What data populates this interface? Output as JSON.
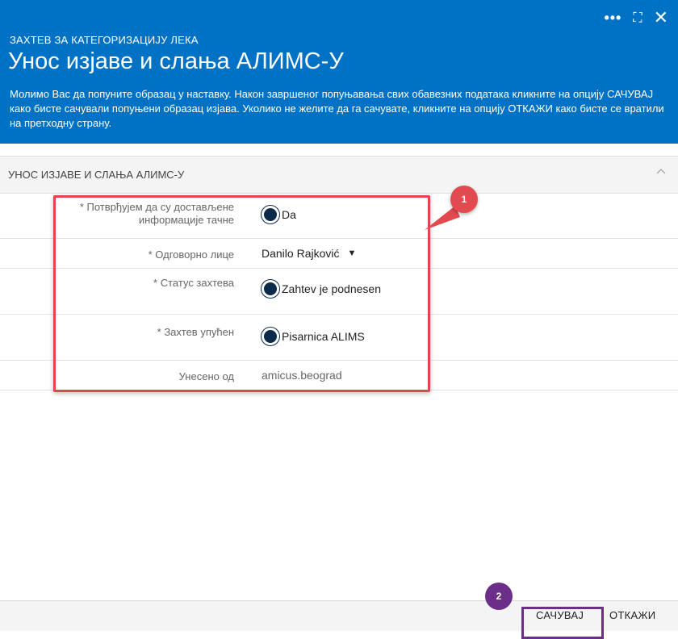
{
  "header": {
    "supertitle": "ЗАХТЕВ ЗА КАТЕГОРИЗАЦИЈУ ЛЕКА",
    "title": "Унос изјаве и слања АЛИМС-У",
    "description": "Молимо Вас да попуните образац у наставку. Након завршеног попуњавања свих обавезних података кликните на опцију САЧУВАЈ како бисте сачували попуњени образац изјава. Уколико не желите да га сачувате, кликните на опцију ОТКАЖИ како бисте се вратили на претходну страну.",
    "controls": {
      "more": "•••",
      "expand": "⛶",
      "close": "✕"
    }
  },
  "section": {
    "title": "УНОС ИЗЈАВЕ И СЛАЊА АЛИМС-У",
    "collapse_icon": "chevron-up-icon"
  },
  "form": {
    "confirm": {
      "label_line1": "* Потврђујем да су достављене",
      "label_line2": "информације тачне",
      "value": "Da"
    },
    "responsible": {
      "label": "* Одговорно лице",
      "value": "Danilo Rajković"
    },
    "status": {
      "label": "* Статус захтева",
      "value": "Zahtev je podnesen"
    },
    "sent_to": {
      "label": "* Захтев упућен",
      "value": "Pisarnica ALIMS"
    },
    "entered_by": {
      "label": "Унесено од",
      "value": "amicus.beograd"
    }
  },
  "annotations": {
    "badge1": "1",
    "badge2": "2"
  },
  "footer": {
    "save": "САЧУВАЈ",
    "cancel": "ОТКАЖИ"
  },
  "colors": {
    "header_bg": "#0072c6",
    "annotation_red": "#e0474c",
    "annotation_purple": "#6b2f8a",
    "radio": "#0c2a4a"
  }
}
